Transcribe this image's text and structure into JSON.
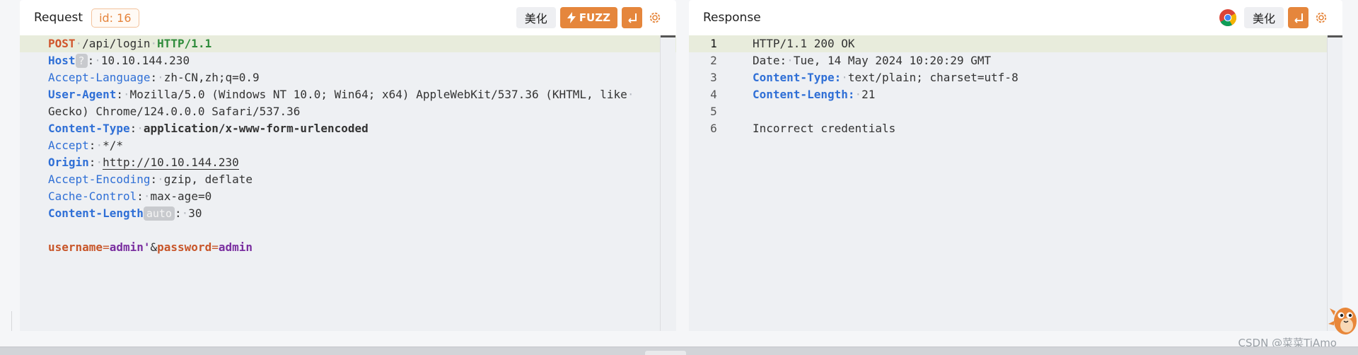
{
  "request": {
    "title": "Request",
    "id_badge": "id: 16",
    "beautify_label": "美化",
    "fuzz_label": "FUZZ",
    "icons": {
      "fuzz": "lightning-icon",
      "wrap": "wrap-line-icon",
      "settings": "gear-icon"
    },
    "lines": {
      "l1": {
        "method": "POST",
        "path": "/api/login",
        "protocol": "HTTP/1.1"
      },
      "l2": {
        "key": "Host",
        "pill": "?",
        "value": "10.10.144.230"
      },
      "l3": {
        "key": "Accept-Language",
        "value": "zh-CN,zh;q=0.9"
      },
      "l4a": {
        "key": "User-Agent",
        "value": "Mozilla/5.0 (Windows NT 10.0; Win64; x64) AppleWebKit/537.36 (KHTML, like"
      },
      "l4b": {
        "value": "Gecko) Chrome/124.0.0.0 Safari/537.36"
      },
      "l5": {
        "key": "Content-Type",
        "value": "application/x-www-form-urlencoded"
      },
      "l6": {
        "key": "Accept",
        "value": "*/*"
      },
      "l7": {
        "key": "Origin",
        "value": "http://10.10.144.230"
      },
      "l8": {
        "key": "Accept-Encoding",
        "value": "gzip, deflate"
      },
      "l9": {
        "key": "Cache-Control",
        "value": "max-age=0"
      },
      "l10": {
        "key": "Content-Length",
        "pill": "auto",
        "value": "30"
      },
      "body": {
        "k1": "username",
        "v1": "admin'",
        "amp": "&",
        "k2": "password",
        "v2": "admin"
      }
    }
  },
  "response": {
    "title": "Response",
    "beautify_label": "美化",
    "icons": {
      "browser": "chrome-icon",
      "wrap": "wrap-line-icon",
      "settings": "gear-icon"
    },
    "line_numbers": [
      "1",
      "2",
      "3",
      "4",
      "5",
      "6"
    ],
    "lines": {
      "l1": {
        "text": "HTTP/1.1 200 OK"
      },
      "l2": {
        "key": "Date:",
        "value": "Tue, 14 May 2024 10:20:29 GMT"
      },
      "l3": {
        "key": "Content-Type:",
        "value": "text/plain; charset=utf-8"
      },
      "l4": {
        "key": "Content-Length:",
        "value": "21"
      },
      "l5": {
        "text": ""
      },
      "l6": {
        "text": "Incorrect credentials"
      }
    }
  },
  "watermark": "CSDN @菜菜TiAmo",
  "colors": {
    "accent": "#e5863c",
    "method": "#d0542b",
    "protocol": "#2e8b3a",
    "header_key": "#2f6fd6",
    "param_value": "#7a2fa0"
  }
}
